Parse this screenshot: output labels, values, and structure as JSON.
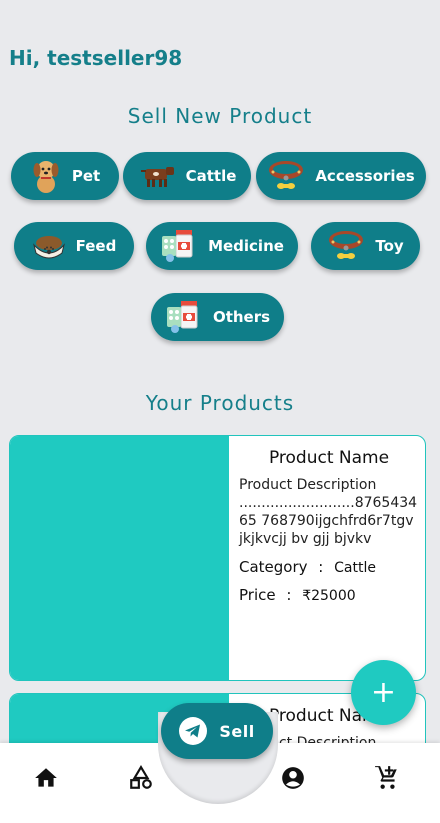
{
  "header": {
    "greeting": "Hi, testseller98"
  },
  "sell_section": {
    "title": "Sell New Product",
    "categories": [
      {
        "label": "Pet",
        "icon": "dog-icon"
      },
      {
        "label": "Cattle",
        "icon": "cow-icon"
      },
      {
        "label": "Accessories",
        "icon": "collar-icon"
      },
      {
        "label": "Feed",
        "icon": "pet-food-icon"
      },
      {
        "label": "Medicine",
        "icon": "medicine-icon"
      },
      {
        "label": "Toy",
        "icon": "collar-icon"
      },
      {
        "label": "Others",
        "icon": "medicine-icon"
      }
    ]
  },
  "products_section": {
    "title": "Your Products",
    "products": [
      {
        "name": "Product Name",
        "description": "Product Description ..........................876543465 768790ijgchfrd6r7tgv jkjkvcjj bv gjj bjvkv",
        "category_label": "Category",
        "category": "Cattle",
        "price_label": "Price",
        "price": "₹25000"
      },
      {
        "name": "Product Name",
        "description": "Product Description"
      }
    ]
  },
  "fab": {
    "label": "+"
  },
  "sell_button": {
    "label": "Sell"
  },
  "bottom_nav": [
    "home-icon",
    "shapes-icon",
    "account-icon",
    "cart-add-icon"
  ],
  "colors": {
    "primary": "#0f7e89",
    "accent": "#1fcac1",
    "background": "#e9eaed"
  }
}
